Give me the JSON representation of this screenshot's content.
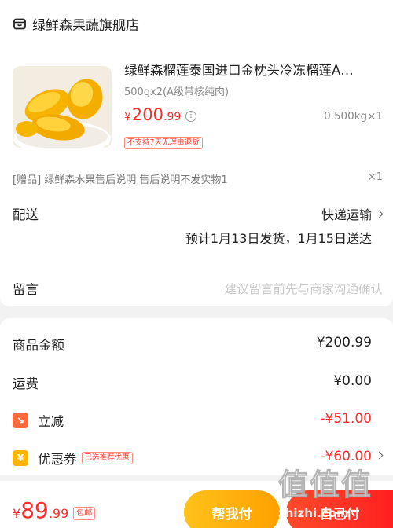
{
  "store": {
    "name": "绿鲜森果蔬旗舰店",
    "icon": "store-icon"
  },
  "product": {
    "title": "绿鲜森榴莲泰国进口金枕头冷冻榴莲A…",
    "spec": "500gx2(A级带核纯肉)",
    "price_symbol": "¥",
    "price_int": "200",
    "price_dec": ".99",
    "quantity": "0.500kg×1",
    "no_return_tag": "不支持7天无理由退货"
  },
  "gift": {
    "text": "[赠品] 绿鲜森水果售后说明 售后说明不发实物1",
    "quantity": "×1"
  },
  "delivery": {
    "label": "配送",
    "method": "快递运输",
    "eta": "预计1月13日发货，1月15日送达"
  },
  "message": {
    "label": "留言",
    "placeholder": "建议留言前先与商家沟通确认"
  },
  "summary": {
    "goods_label": "商品金额",
    "goods_value": "¥200.99",
    "freight_label": "运费",
    "freight_value": "¥0.00",
    "discount_label": "立减",
    "discount_value": "-¥51.00",
    "coupon_label": "优惠券",
    "coupon_tag": "已选推荐优惠",
    "coupon_value": "-¥60.00"
  },
  "bottom": {
    "total_symbol": "¥",
    "total_int": "89",
    "total_dec": ".99",
    "free_shipping": "包邮",
    "help_pay": "帮我付",
    "self_pay": "自己付"
  },
  "watermark": {
    "glyphs": "值值值",
    "url": "zhizhi.com"
  },
  "colors": {
    "accent_red": "#ff2b2b",
    "help_button": "#ffb000",
    "pay_button": "#ff3a2a"
  }
}
